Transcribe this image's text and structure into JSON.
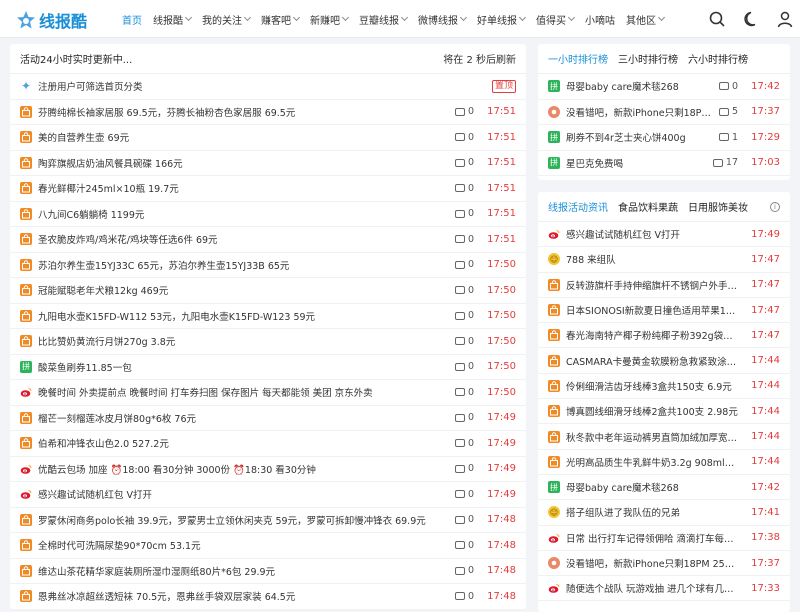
{
  "header": {
    "logo_text": "线报酷",
    "nav": [
      {
        "label": "首页",
        "active": true,
        "dropdown": false
      },
      {
        "label": "线报酷",
        "active": false,
        "dropdown": true
      },
      {
        "label": "我的关注",
        "active": false,
        "dropdown": true
      },
      {
        "label": "赚客吧",
        "active": false,
        "dropdown": true
      },
      {
        "label": "新赚吧",
        "active": false,
        "dropdown": true
      },
      {
        "label": "豆瓣线报",
        "active": false,
        "dropdown": true
      },
      {
        "label": "微博线报",
        "active": false,
        "dropdown": true
      },
      {
        "label": "好单线报",
        "active": false,
        "dropdown": true
      },
      {
        "label": "值得买",
        "active": false,
        "dropdown": true
      },
      {
        "label": "小嘀咕",
        "active": false,
        "dropdown": false
      },
      {
        "label": "其他区",
        "active": false,
        "dropdown": true
      }
    ],
    "icons": [
      "search-icon",
      "moon-icon",
      "user-icon"
    ],
    "accent": "#1a8fd8"
  },
  "feed": {
    "title": "活动24小时实时更新中...",
    "refresh": "将在 2 秒后刷新",
    "items": [
      {
        "src": "star",
        "text": "注册用户可筛选首页分类",
        "comments": "",
        "time": "",
        "pin": "置顶"
      },
      {
        "src": "shop",
        "text": "芬腾纯棉长袖家居服 69.5元，芬腾长袖粉杏色家居服 69.5元",
        "comments": "0",
        "time": "17:51"
      },
      {
        "src": "shop",
        "text": "美的自营养生壶 69元",
        "comments": "0",
        "time": "17:51"
      },
      {
        "src": "shop",
        "text": "陶弈旗舰店奶油风餐具碗碟 166元",
        "comments": "0",
        "time": "17:51"
      },
      {
        "src": "shop",
        "text": "春光鲜椰汁245ml×10瓶 19.7元",
        "comments": "0",
        "time": "17:51"
      },
      {
        "src": "shop",
        "text": "八九间C6躺躺椅 1199元",
        "comments": "0",
        "time": "17:51"
      },
      {
        "src": "shop",
        "text": "圣农脆皮炸鸡/鸡米花/鸡块等任选6件 69元",
        "comments": "0",
        "time": "17:51"
      },
      {
        "src": "shop",
        "text": "苏泊尔养生壶15YJ33C 65元，苏泊尔养生壶15YJ33B 65元",
        "comments": "0",
        "time": "17:50"
      },
      {
        "src": "shop",
        "text": "冠能赋聪老年犬粮12kg 469元",
        "comments": "0",
        "time": "17:50"
      },
      {
        "src": "shop",
        "text": "九阳电水壶K15FD-W112 53元，九阳电水壶K15FD-W123 59元",
        "comments": "0",
        "time": "17:50"
      },
      {
        "src": "shop",
        "text": "比比赞奶黄流行月饼270g 3.8元",
        "comments": "0",
        "time": "17:50"
      },
      {
        "src": "pdd",
        "text": "酸菜鱼刷券11.85一包",
        "comments": "0",
        "time": "17:50"
      },
      {
        "src": "weibo",
        "text": "晚餐时间 外卖提前点 晚餐时间 打车券扫图 保存图片 每天都能领 美团 京东外卖",
        "comments": "0",
        "time": "17:50"
      },
      {
        "src": "shop",
        "text": "榴芒一刻榴莲冰皮月饼80g*6枚 76元",
        "comments": "0",
        "time": "17:49"
      },
      {
        "src": "shop",
        "text": "伯希和冲锋衣山色2.0 527.2元",
        "comments": "0",
        "time": "17:49"
      },
      {
        "src": "weibo",
        "text": "优酷云包场 加座 ⏰18:00 看30分钟 3000份 ⏰18:30 看30分钟",
        "comments": "0",
        "time": "17:49"
      },
      {
        "src": "weibo",
        "text": "感兴趣试试随机红包 V打开",
        "comments": "0",
        "time": "17:49"
      },
      {
        "src": "shop",
        "text": "罗蒙休闲商务polo长袖 39.9元，罗蒙男士立领休闲夹克 59元，罗蒙可拆卸慢冲锋衣 69.9元",
        "comments": "0",
        "time": "17:48"
      },
      {
        "src": "shop",
        "text": "全棉时代可洗隔尿垫90*70cm 53.1元",
        "comments": "0",
        "time": "17:48"
      },
      {
        "src": "shop",
        "text": "维达山茶花精华家庭装厕所湿巾湿厕纸80片*6包 29.9元",
        "comments": "0",
        "time": "17:48"
      },
      {
        "src": "shop",
        "text": "恩弗丝冰凉超丝透短袜 70.5元，恩弗丝手袋双层家装 64.5元",
        "comments": "0",
        "time": "17:48"
      }
    ]
  },
  "rank": {
    "tabs": [
      {
        "label": "一小时排行榜",
        "active": true
      },
      {
        "label": "三小时排行榜",
        "active": false
      },
      {
        "label": "六小时排行榜",
        "active": false
      }
    ],
    "items": [
      {
        "src": "pdd",
        "text": "母婴baby care魔术毯268",
        "comments": "0",
        "time": "17:42"
      },
      {
        "src": "mix",
        "text": "没看错吧，新款iPhone只剩18PM 256…",
        "comments": "5",
        "time": "17:37"
      },
      {
        "src": "pdd",
        "text": "刷券不到4r芝士夹心饼400g",
        "comments": "1",
        "time": "17:29"
      },
      {
        "src": "pdd",
        "text": "星巴克免费喝",
        "comments": "17",
        "time": "17:03"
      }
    ]
  },
  "news": {
    "tabs": [
      {
        "label": "线报活动资讯",
        "active": true
      },
      {
        "label": "食品饮料果蔬",
        "active": false
      },
      {
        "label": "日用服饰美妆",
        "active": false
      }
    ],
    "items": [
      {
        "src": "weibo",
        "text": "感兴趣试试随机红包 V打开",
        "time": "17:49"
      },
      {
        "src": "smile",
        "text": "788 来组队",
        "time": "17:47"
      },
      {
        "src": "shop",
        "text": "反转游旗杆手持伸缩旗杆不锈钢户外手提…",
        "time": "17:47"
      },
      {
        "src": "shop",
        "text": "日本SIONOSI新款夏日撞色适用苹果17P…",
        "time": "17:47"
      },
      {
        "src": "shop",
        "text": "春光海南特产椰子粉纯椰子粉392g袋装 …",
        "time": "17:47"
      },
      {
        "src": "shop",
        "text": "CASMARA卡曼黄金软膜粉急救紧致涂抹…",
        "time": "17:44"
      },
      {
        "src": "shop",
        "text": "伶俐细滑洁齿牙线棒3盒共150支 6.9元",
        "time": "17:44"
      },
      {
        "src": "shop",
        "text": "博真圆线细滑牙线棒2盒共100支 2.98元",
        "time": "17:44"
      },
      {
        "src": "shop",
        "text": "秋冬款中老年运动裤男直筒加绒加厚宽松…",
        "time": "17:44"
      },
      {
        "src": "shop",
        "text": "光明高品质生牛乳鲜牛奶3.2g 908ml*3…",
        "time": "17:44"
      },
      {
        "src": "pdd",
        "text": "母婴baby care魔术毯268",
        "time": "17:42"
      },
      {
        "src": "smile",
        "text": "搭子组队进了我队伍的兄弟",
        "time": "17:41"
      },
      {
        "src": "weibo",
        "text": "日常 出行打车记得领佣哈 滴滴打车每天…",
        "time": "17:38"
      },
      {
        "src": "mix",
        "text": "没看错吧，新款iPhone只剩18PM 256…",
        "time": "17:37"
      },
      {
        "src": "weibo",
        "text": "随便选个战队 玩游戏抽 进几个球有几次…",
        "time": "17:33"
      }
    ]
  }
}
